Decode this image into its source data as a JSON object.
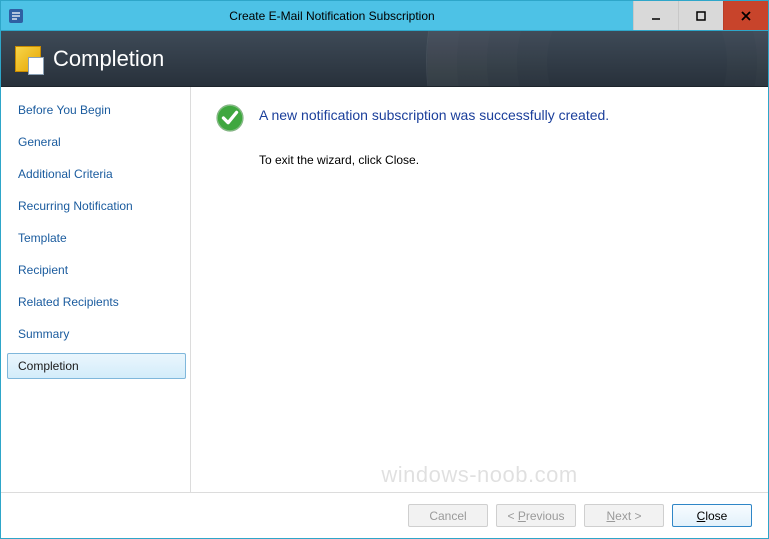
{
  "window": {
    "title": "Create E-Mail Notification Subscription"
  },
  "banner": {
    "title": "Completion"
  },
  "sidebar": {
    "items": [
      {
        "label": "Before You Begin",
        "active": false
      },
      {
        "label": "General",
        "active": false
      },
      {
        "label": "Additional Criteria",
        "active": false
      },
      {
        "label": "Recurring Notification",
        "active": false
      },
      {
        "label": "Template",
        "active": false
      },
      {
        "label": "Recipient",
        "active": false
      },
      {
        "label": "Related Recipients",
        "active": false
      },
      {
        "label": "Summary",
        "active": false
      },
      {
        "label": "Completion",
        "active": true
      }
    ]
  },
  "main": {
    "heading": "A new notification subscription was successfully created.",
    "body": "To exit the wizard, click Close."
  },
  "footer": {
    "cancel": "Cancel",
    "previous": "< Previous",
    "next": "Next >",
    "close": "Close"
  },
  "watermark": "windows-noob.com"
}
